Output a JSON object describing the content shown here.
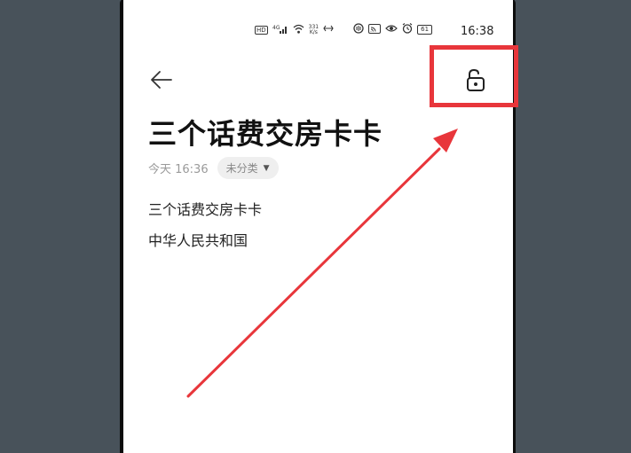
{
  "status_bar": {
    "hd_label": "HD",
    "signal_label": "4G",
    "speed_value": "331",
    "speed_unit": "K/s",
    "battery": "61",
    "time": "16:38"
  },
  "toolbar": {
    "back_icon": "arrow-left-icon",
    "lock_icon": "unlocked-padlock-icon"
  },
  "note": {
    "title": "三个话费交房卡卡",
    "timestamp": "今天 16:36",
    "category": "未分类",
    "category_caret": "▼",
    "lines": [
      "三个话费交房卡卡",
      "中华人民共和国"
    ]
  },
  "annotation": {
    "color": "#e8363b"
  }
}
